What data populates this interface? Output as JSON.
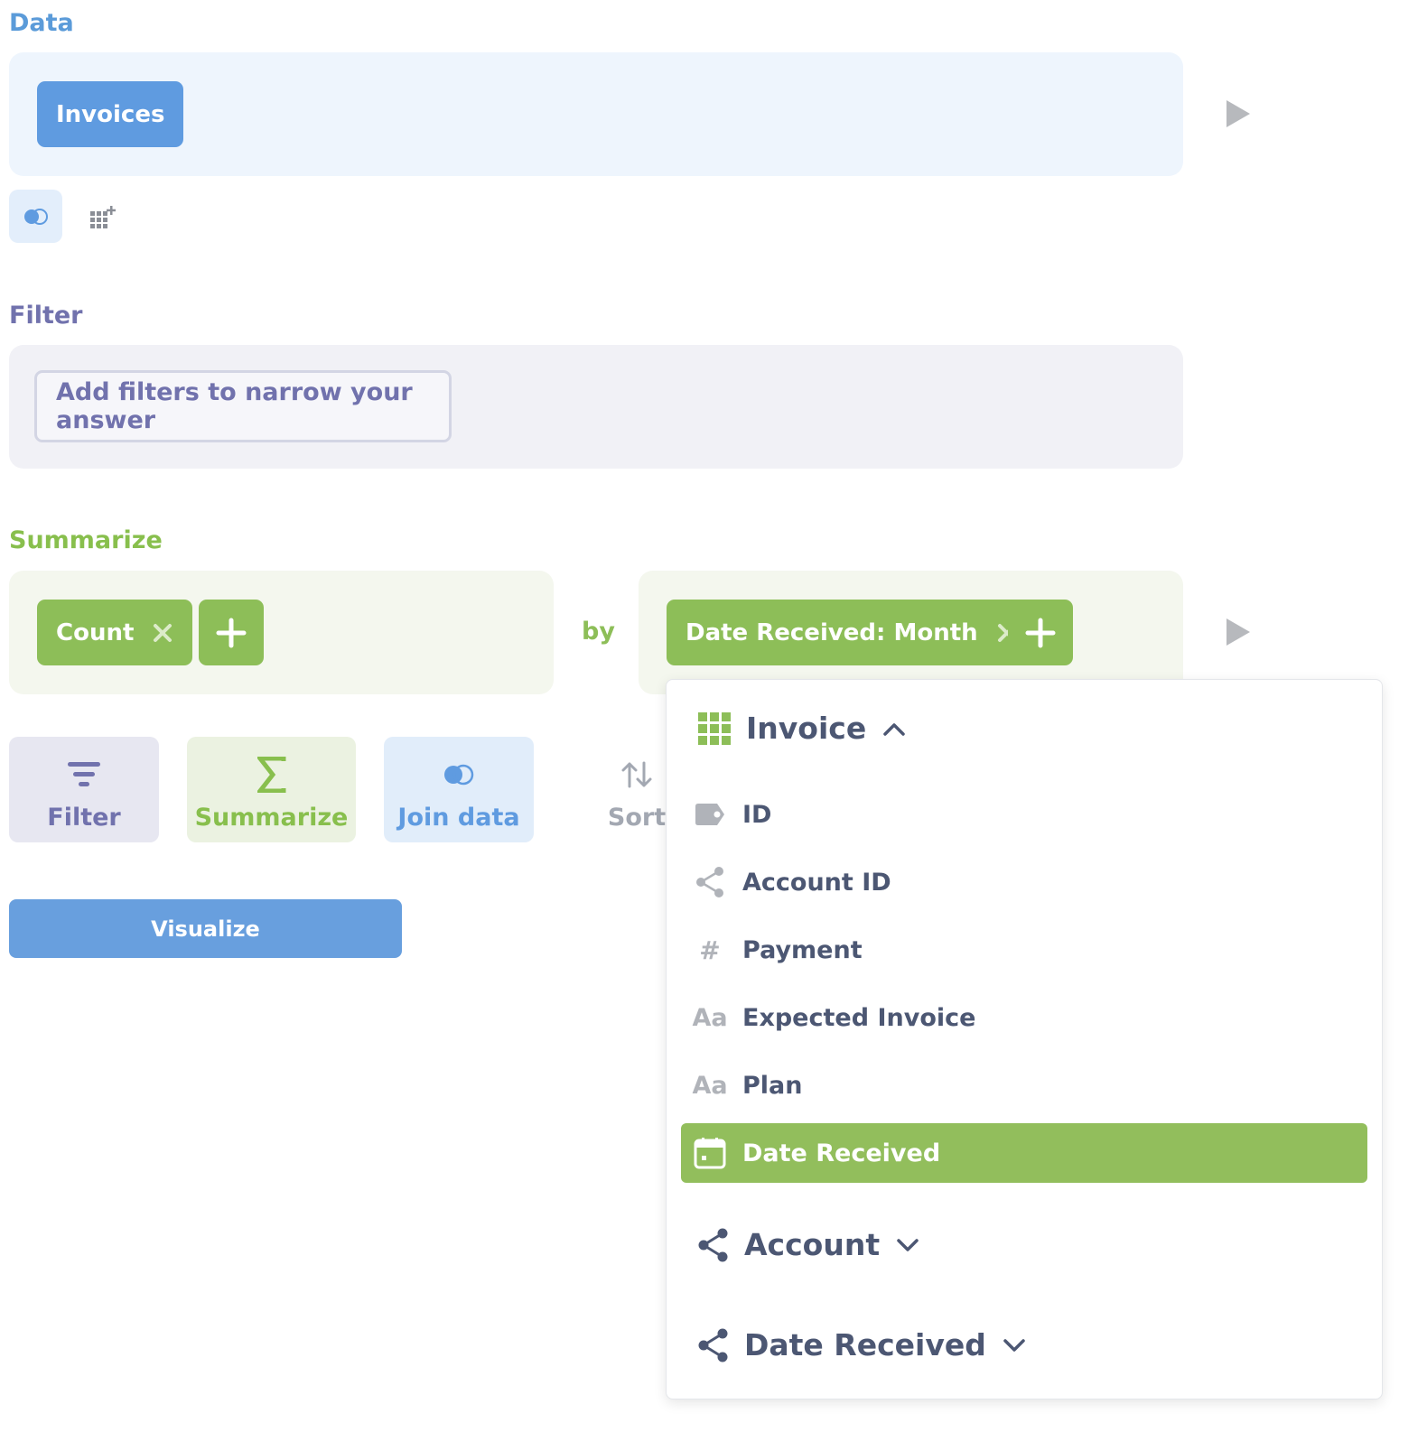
{
  "sections": {
    "data": "Data",
    "filter": "Filter",
    "summarize": "Summarize"
  },
  "data_step": {
    "source": "Invoices",
    "icons": [
      "join-icon",
      "custom-column-icon",
      "play-icon"
    ]
  },
  "filter_step": {
    "placeholder": "Add filters to narrow your answer"
  },
  "summarize_step": {
    "metric": "Count",
    "by_label": "by",
    "breakout": "Date Received: Month"
  },
  "actions": {
    "filter": "Filter",
    "summarize": "Summarize",
    "join": "Join data",
    "sort": "Sort"
  },
  "visualize": "Visualize",
  "popover": {
    "table_group": "Invoice",
    "fields": [
      {
        "label": "ID",
        "icon": "label-icon"
      },
      {
        "label": "Account ID",
        "icon": "foreign-key-icon"
      },
      {
        "label": "Payment",
        "icon": "number-icon"
      },
      {
        "label": "Expected Invoice",
        "icon": "text-icon"
      },
      {
        "label": "Plan",
        "icon": "text-icon"
      },
      {
        "label": "Date Received",
        "icon": "calendar-icon",
        "selected": true
      }
    ],
    "other_groups": [
      "Account",
      "Date Received"
    ]
  },
  "colors": {
    "data": "#5f9be0",
    "filter": "#7172ad",
    "summarize": "#8dbe58",
    "text": "#4c5773"
  }
}
